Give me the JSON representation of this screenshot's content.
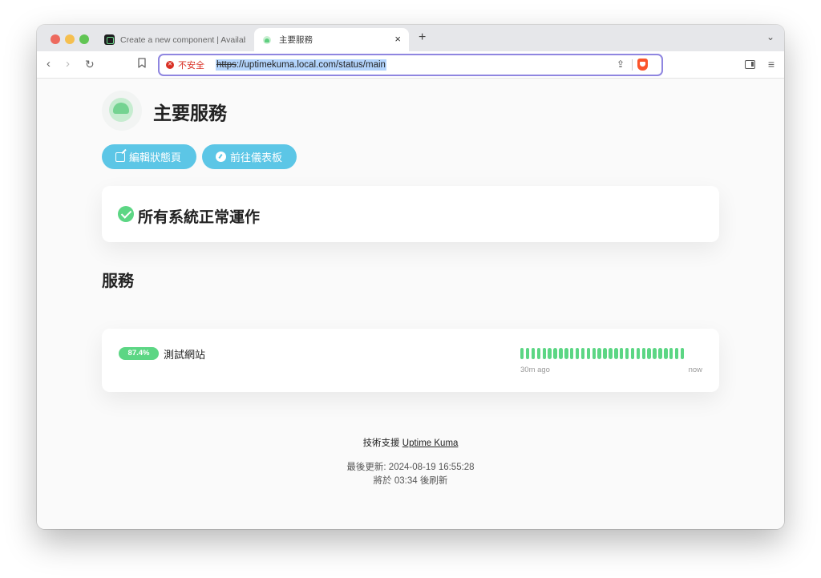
{
  "browser": {
    "tabs": [
      {
        "title": "Create a new component | Availab"
      },
      {
        "title": "主要服務"
      }
    ],
    "tab_close": "×",
    "new_tab": "+",
    "tabs_menu": "⌄",
    "nav": {
      "back": "‹",
      "forward": "›",
      "reload": "↻"
    },
    "security_label": "不安全",
    "security_icon": "✕",
    "url_scheme": "https",
    "url_rest": "://uptimekuma.local.com/status/main",
    "share": "⇪",
    "menu": "≡"
  },
  "page": {
    "title": "主要服務",
    "buttons": {
      "edit": "編輯狀態頁",
      "dashboard": "前往儀表板"
    },
    "overall_status": "所有系統正常運作",
    "section_title": "服務",
    "monitors": [
      {
        "uptime": "87.4%",
        "name": "測試網站",
        "beat_count": 30,
        "beat_color": "#5cd684",
        "time_start": "30m ago",
        "time_end": "now"
      }
    ],
    "footer": {
      "powered_prefix": "技術支援",
      "powered_link": "Uptime Kuma",
      "last_updated": "最後更新: 2024-08-19 16:55:28",
      "refresh": "將於 03:34 後刷新"
    }
  },
  "colors": {
    "accent_button": "#5cc6e6",
    "status_green": "#5cd684",
    "insecure_red": "#d93025"
  }
}
